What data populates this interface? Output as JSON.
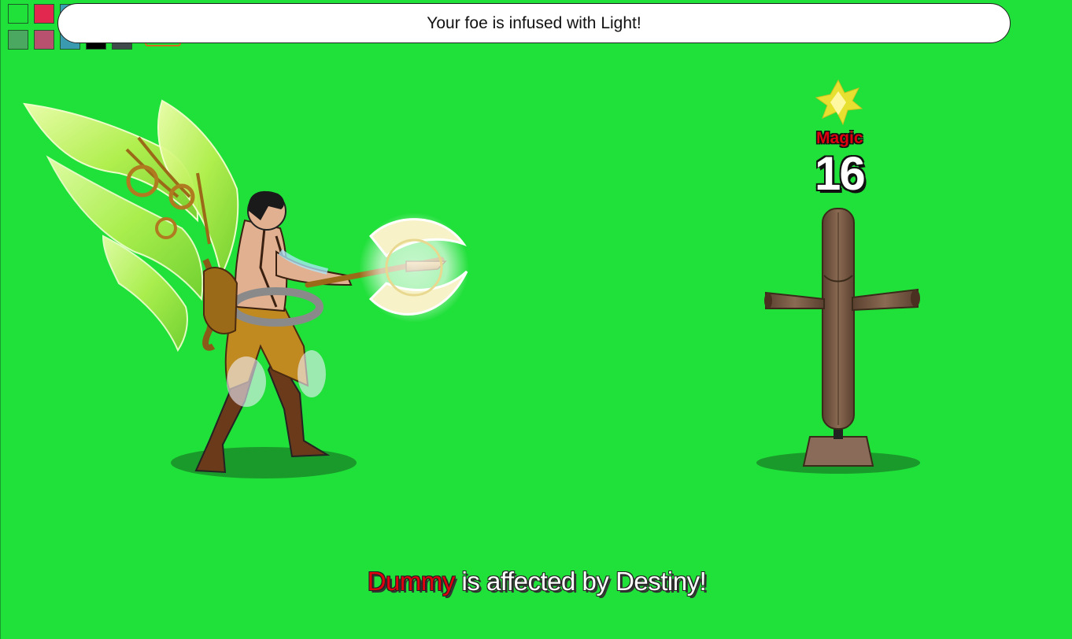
{
  "colors": {
    "background": "#20e03a",
    "damage_label": "#e00010",
    "enemy_name": "#e00010"
  },
  "swatches": {
    "row1": [
      "#20e03a",
      "#e32850",
      "#3aa0b8"
    ],
    "row2": [
      "#4aa860",
      "#b85070",
      "#3a9ab0",
      "#000000",
      "#404a4a"
    ]
  },
  "banner": {
    "message": "Your foe is infused with Light!"
  },
  "combat": {
    "damage_type": "Magic",
    "damage_value": "16",
    "element_icon": "light-star-icon"
  },
  "status": {
    "target": "Dummy",
    "message": " is affected by Destiny!"
  },
  "characters": {
    "player": "winged-warrior-sprite",
    "enemy": "training-dummy-sprite"
  }
}
